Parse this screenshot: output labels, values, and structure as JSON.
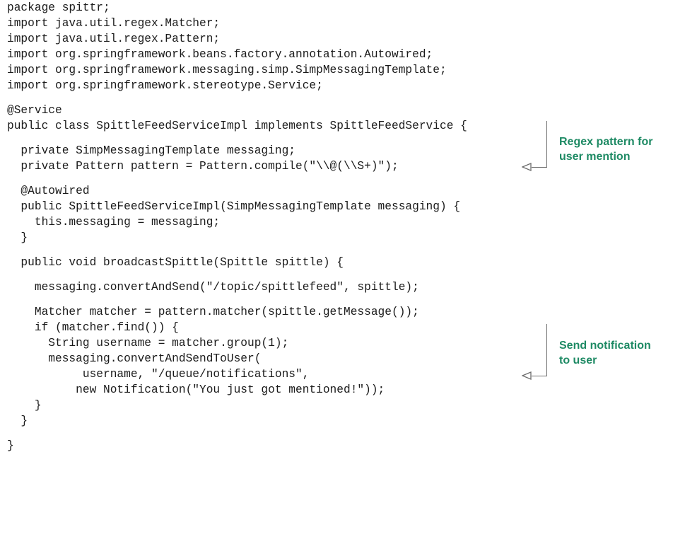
{
  "code_lines": [
    "package spittr;",
    "import java.util.regex.Matcher;",
    "import java.util.regex.Pattern;",
    "import org.springframework.beans.factory.annotation.Autowired;",
    "import org.springframework.messaging.simp.SimpMessagingTemplate;",
    "import org.springframework.stereotype.Service;",
    "@Service",
    "public class SpittleFeedServiceImpl implements SpittleFeedService {",
    "  private SimpMessagingTemplate messaging;",
    "  private Pattern pattern = Pattern.compile(\"\\\\@(\\\\S+)\");",
    "  @Autowired",
    "  public SpittleFeedServiceImpl(SimpMessagingTemplate messaging) {",
    "    this.messaging = messaging;",
    "  }",
    "  public void broadcastSpittle(Spittle spittle) {",
    "    messaging.convertAndSend(\"/topic/spittlefeed\", spittle);",
    "    Matcher matcher = pattern.matcher(spittle.getMessage());",
    "    if (matcher.find()) {",
    "      String username = matcher.group(1);",
    "      messaging.convertAndSendToUser(",
    "           username, \"/queue/notifications\",",
    "          new Notification(\"You just got mentioned!\"));",
    "    }",
    "  }",
    "}"
  ],
  "annotations": [
    {
      "text": "Regex pattern for\nuser mention"
    },
    {
      "text": "Send notification\nto user"
    }
  ],
  "colors": {
    "code_text": "#1a1a1a",
    "annotation_text": "#1e8a64",
    "bracket": "#6c6c6c",
    "background": "#ffffff"
  }
}
